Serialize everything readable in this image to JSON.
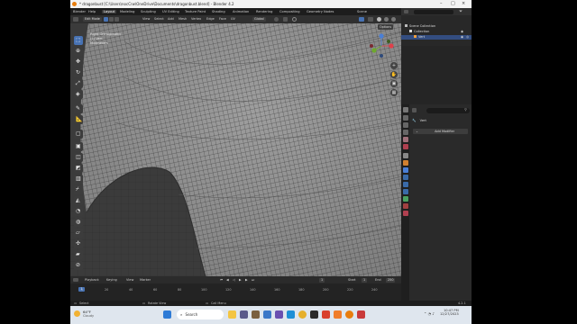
{
  "window": {
    "title": "* dragonbust [C:\\Users\\nocCrw\\OneDrive\\Documents\\dragonbust.blend] - Blender 4.2"
  },
  "menubar": {
    "items": [
      "Blender",
      "Help",
      "Layout",
      "Modeling",
      "Sculpting",
      "UV Editing",
      "Texture Paint",
      "Shading",
      "Animation",
      "Rendering",
      "Compositing",
      "Geometry Nodes"
    ],
    "active": "Layout",
    "scene_label": "Scene",
    "view_layer_label": "ViewLayer"
  },
  "viewport_header": {
    "mode": "Edit Mode",
    "menus": [
      "View",
      "Select",
      "Add",
      "Mesh",
      "Vertex",
      "Edge",
      "Face",
      "UV"
    ],
    "orientation": "Global",
    "options_label": "Options"
  },
  "viewport": {
    "view_name": "Right Orthographic",
    "object_info": "(1) Vert",
    "units": "Millimeters",
    "gizmo": {
      "x": "X",
      "y": "Y",
      "z": "Z",
      "x_color": "#e0404a",
      "y_color": "#6ea82d",
      "z_color": "#4a7fd6"
    }
  },
  "toolbar": {
    "tools": [
      "select-box",
      "cursor",
      "move",
      "rotate",
      "scale",
      "transform",
      "annotate",
      "measure",
      "add-cube",
      "extrude",
      "inset",
      "bevel",
      "loop-cut",
      "knife",
      "poly-build",
      "spin",
      "smooth",
      "edge-slide",
      "shrink-fatten",
      "shear",
      "rip"
    ]
  },
  "outliner": {
    "rows": [
      {
        "label": "Scene Collection",
        "selected": false
      },
      {
        "label": "Collection",
        "selected": false
      },
      {
        "label": "Vert",
        "selected": true
      }
    ]
  },
  "properties": {
    "object_name": "Vert",
    "add_modifier_label": "Add Modifier"
  },
  "timeline": {
    "menus": [
      "Playback",
      "Keying",
      "View",
      "Marker"
    ],
    "current_frame": "1",
    "start_label": "Start",
    "start_value": "1",
    "end_label": "End",
    "end_value": "250",
    "ticks": [
      "0",
      "20",
      "40",
      "60",
      "80",
      "100",
      "120",
      "140",
      "160",
      "180",
      "200",
      "220",
      "240"
    ]
  },
  "statusbar": {
    "items": [
      "Select",
      "Rotate View",
      "Call Menu"
    ],
    "version": "4.2.1"
  },
  "taskbar": {
    "weather_temp": "64°F",
    "weather_desc": "Cloudy",
    "search_placeholder": "Search",
    "time": "10:47 PM",
    "date": "12/27/2023",
    "colors": {
      "accent": "#4772b3",
      "selection": "#334d80"
    }
  }
}
